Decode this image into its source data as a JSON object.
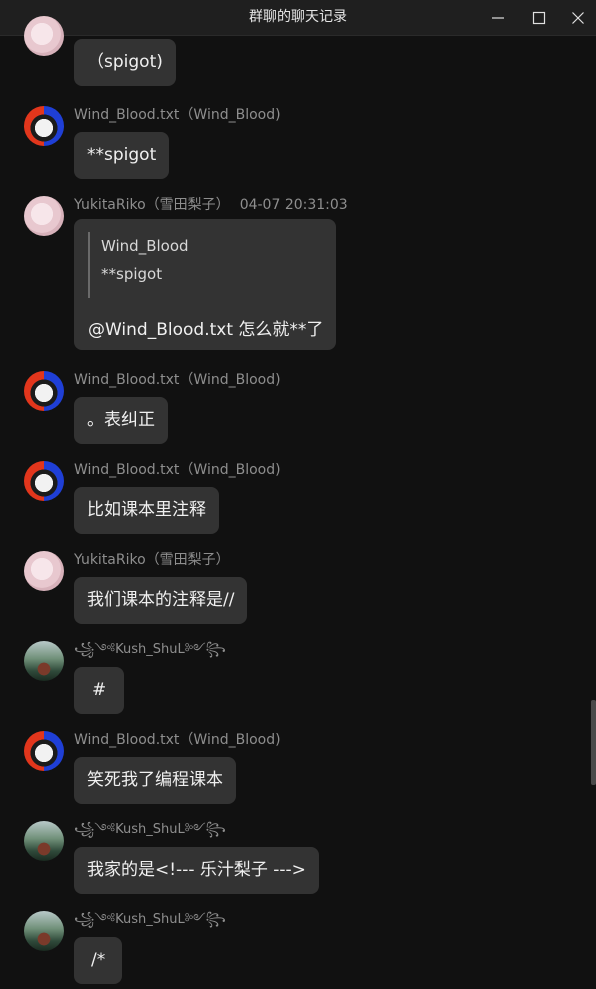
{
  "window": {
    "title": "群聊的聊天记录"
  },
  "messages": [
    {
      "id": "m0",
      "avatar": "riko-avatar",
      "header": "",
      "timestamp": "",
      "text": "（spigot)"
    },
    {
      "id": "m1",
      "avatar": "wind-avatar",
      "header": "Wind_Blood.txt（Wind_Blood)",
      "timestamp": "",
      "text": "**spigot"
    },
    {
      "id": "m2",
      "avatar": "riko-avatar",
      "header": "YukitaRiko（雪田梨子）",
      "timestamp": "04-07 20:31:03",
      "quote": {
        "author": "Wind_Blood",
        "text": "**spigot"
      },
      "text": "@Wind_Blood.txt 怎么就**了"
    },
    {
      "id": "m3",
      "avatar": "wind-avatar",
      "header": "Wind_Blood.txt（Wind_Blood)",
      "timestamp": "",
      "text": "。表纠正"
    },
    {
      "id": "m4",
      "avatar": "wind-avatar",
      "header": "Wind_Blood.txt（Wind_Blood)",
      "timestamp": "",
      "text": "比如课本里注释"
    },
    {
      "id": "m5",
      "avatar": "riko-avatar",
      "header": "YukitaRiko（雪田梨子）",
      "timestamp": "",
      "text": "我们课本的注释是//"
    },
    {
      "id": "m6",
      "avatar": "kush-avatar",
      "header": "꧁༺Kush_ShuL༻꧂",
      "timestamp": "",
      "text": "#"
    },
    {
      "id": "m7",
      "avatar": "wind-avatar",
      "header": "Wind_Blood.txt（Wind_Blood)",
      "timestamp": "",
      "text": "笑死我了编程课本"
    },
    {
      "id": "m8",
      "avatar": "kush-avatar",
      "header": "꧁༺Kush_ShuL༻꧂",
      "timestamp": "",
      "text": "我家的是<!--- 乐汁梨子 --->"
    },
    {
      "id": "m9",
      "avatar": "kush-avatar",
      "header": "꧁༺Kush_ShuL༻꧂",
      "timestamp": "",
      "text": "/*"
    }
  ]
}
